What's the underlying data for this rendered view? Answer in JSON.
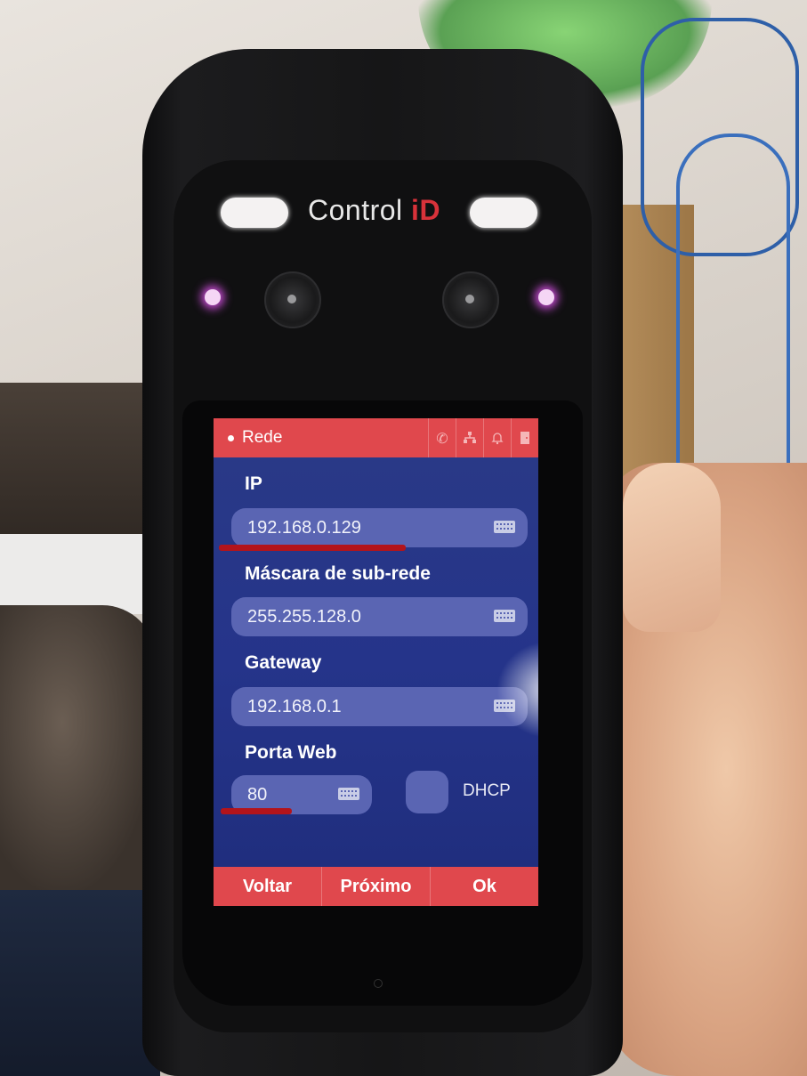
{
  "device": {
    "brand_prefix": "Control ",
    "brand_suffix": "iD"
  },
  "screen": {
    "header": {
      "title": "Rede",
      "icons": [
        "phone-icon",
        "network-icon",
        "bell-icon",
        "door-icon"
      ]
    },
    "fields": {
      "ip": {
        "label": "IP",
        "value": "192.168.0.129"
      },
      "netmask": {
        "label": "Máscara de sub-rede",
        "value": "255.255.128.0"
      },
      "gateway": {
        "label": "Gateway",
        "value": "192.168.0.1"
      },
      "web_port": {
        "label": "Porta Web",
        "value": "80"
      }
    },
    "dhcp": {
      "label": "DHCP",
      "checked": false
    },
    "footer": {
      "back": "Voltar",
      "next": "Próximo",
      "ok": "Ok"
    }
  },
  "colors": {
    "accent": "#e0484d",
    "screen_bg": "#25348a",
    "field_bg": "#5a65b3",
    "annotation": "#b3141b"
  }
}
